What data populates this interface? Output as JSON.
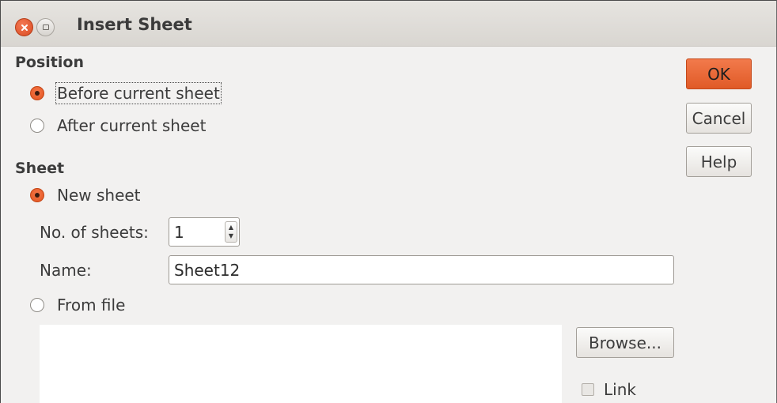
{
  "window": {
    "title": "Insert Sheet"
  },
  "position": {
    "heading": "Position",
    "before_label": "Before current sheet",
    "after_label": "After current sheet"
  },
  "sheet": {
    "heading": "Sheet",
    "new_sheet_label": "New sheet",
    "num_sheets_label": "No. of sheets:",
    "num_sheets_value": "1",
    "name_label": "Name:",
    "name_value": "Sheet12",
    "from_file_label": "From file",
    "browse_label": "Browse...",
    "link_label": "Link"
  },
  "buttons": {
    "ok": "OK",
    "cancel": "Cancel",
    "help": "Help"
  },
  "colors": {
    "accent": "#e85b27",
    "background": "#f2f1f0"
  },
  "icons": [
    "close-icon",
    "maximize-icon",
    "spin-up-icon",
    "spin-down-icon"
  ]
}
